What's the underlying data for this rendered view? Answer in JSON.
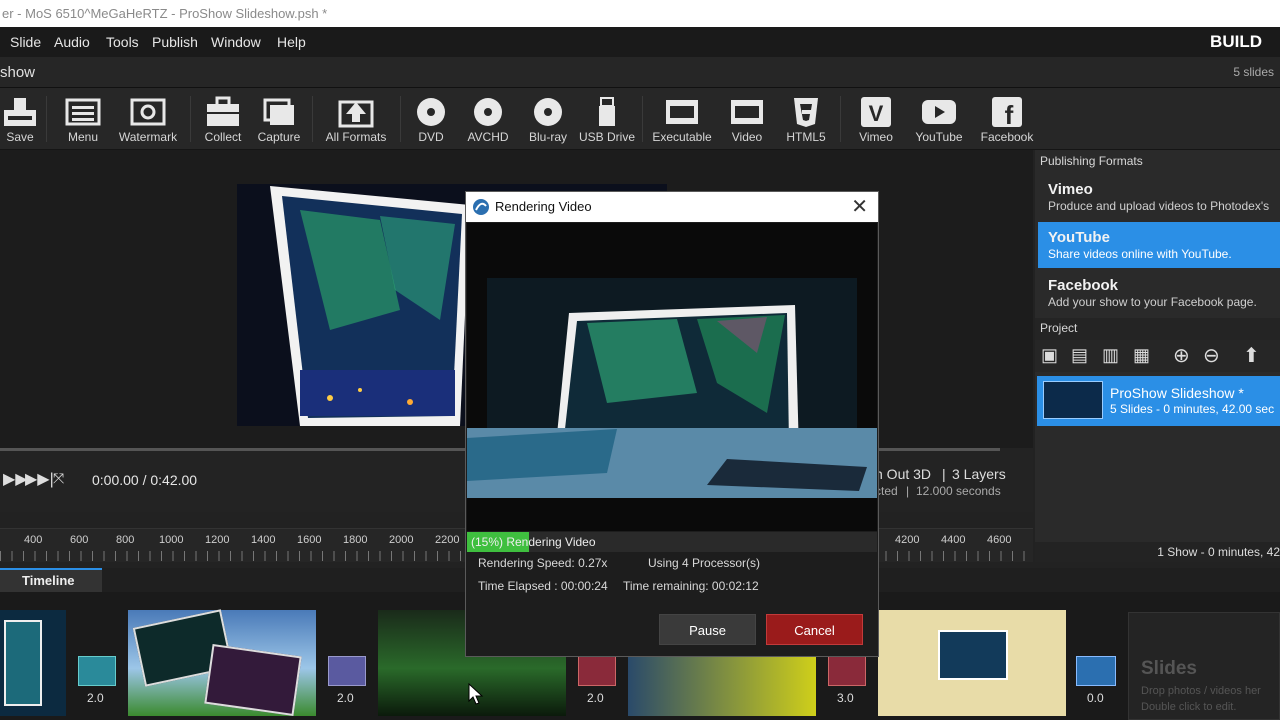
{
  "window": {
    "title": "er - MoS 6510^MeGaHeRTZ - ProShow Slideshow.psh *"
  },
  "menu": [
    "Slide",
    "Audio",
    "Tools",
    "Publish",
    "Window",
    "Help"
  ],
  "build_label": "BUILD",
  "subheader": {
    "title": "show",
    "slide_count": "5 slides"
  },
  "toolbar": {
    "save": "Save",
    "menu": "Menu",
    "watermark": "Watermark",
    "collect": "Collect",
    "capture": "Capture",
    "all_formats": "All Formats",
    "dvd": "DVD",
    "avchd": "AVCHD",
    "bluray": "Blu-ray",
    "usb": "USB Drive",
    "executable": "Executable",
    "video": "Video",
    "html5": "HTML5",
    "vimeo": "Vimeo",
    "youtube": "YouTube",
    "facebook": "Facebook"
  },
  "player": {
    "time": "0:00.00 / 0:42.00",
    "slide_info_1": "n Out 3D",
    "slide_info_layers": "3 Layers",
    "slide_info_2": "cted",
    "slide_info_dur": "12.000 seconds"
  },
  "ruler": [
    "400",
    "600",
    "800",
    "1000",
    "1200",
    "1400",
    "1600",
    "1800",
    "2000",
    "2200",
    "4200",
    "4400",
    "4600"
  ],
  "timeline_tab": "Timeline",
  "transitions": [
    "2.0",
    "2.0",
    "2.0",
    "3.0",
    "0.0"
  ],
  "slides_placeholder": {
    "title": "Slides",
    "line1": "Drop photos / videos her",
    "line2": "Double click to edit."
  },
  "publishing": {
    "header": "Publishing Formats",
    "items": [
      {
        "name": "Vimeo",
        "desc": "Produce and upload videos to Photodex's"
      },
      {
        "name": "YouTube",
        "desc": "Share videos online with YouTube."
      },
      {
        "name": "Facebook",
        "desc": "Add your show to your Facebook page."
      }
    ],
    "selected": "YouTube"
  },
  "project": {
    "header": "Project",
    "show_name": "ProShow Slideshow *",
    "show_info": "5 Slides - 0 minutes, 42.00 sec",
    "summary": "1 Show - 0 minutes, 42"
  },
  "dialog": {
    "title": "Rendering Video",
    "progress_label": "(15%) Rendering Video",
    "progress": 0.15,
    "speed": "Rendering Speed: 0.27x",
    "processors": "Using 4 Processor(s)",
    "elapsed": "Time Elapsed  :  00:00:24",
    "remaining": "Time remaining: 00:02:12",
    "pause": "Pause",
    "cancel": "Cancel"
  },
  "colors": {
    "accent": "#2b8fe6",
    "progress": "#3fbf3f",
    "cancel": "#9a1b1b"
  }
}
